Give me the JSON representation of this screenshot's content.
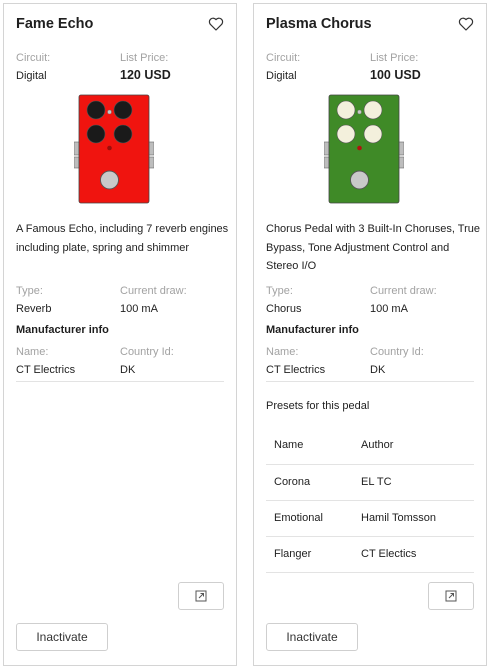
{
  "cards": [
    {
      "title": "Fame Echo",
      "circuit_label": "Circuit:",
      "circuit_value": "Digital",
      "price_label": "List Price:",
      "price_value": "120 USD",
      "pedal_color": "#f0140f",
      "knob_color": "#1a1a1a",
      "description": "A Famous Echo, including 7 reverb engines including plate, spring and shimmer",
      "type_label": "Type:",
      "type_value": "Reverb",
      "draw_label": "Current draw:",
      "draw_value": "100 mA",
      "manufacturer_heading": "Manufacturer info",
      "name_label": "Name:",
      "name_value": "CT Electrics",
      "country_label": "Country Id:",
      "country_value": "DK",
      "inactivate_label": "Inactivate"
    },
    {
      "title": "Plasma Chorus",
      "circuit_label": "Circuit:",
      "circuit_value": "Digital",
      "price_label": "List Price:",
      "price_value": "100 USD",
      "pedal_color": "#3f8a27",
      "knob_color": "#f3f0dc",
      "description": "Chorus Pedal with 3 Built-In Choruses, True Bypass, Tone Adjustment Control and Stereo I/O",
      "type_label": "Type:",
      "type_value": "Chorus",
      "draw_label": "Current draw:",
      "draw_value": "100 mA",
      "manufacturer_heading": "Manufacturer info",
      "name_label": "Name:",
      "name_value": "CT Electrics",
      "country_label": "Country Id:",
      "country_value": "DK",
      "presets_title": "Presets for this pedal",
      "presets_headers": [
        "Name",
        "Author"
      ],
      "presets": [
        {
          "name": "Corona",
          "author": "EL TC"
        },
        {
          "name": "Emotional",
          "author": "Hamil Tomsson"
        },
        {
          "name": "Flanger",
          "author": "CT Electics"
        }
      ],
      "inactivate_label": "Inactivate"
    }
  ],
  "icons": {
    "favorite": "heart-outline-icon",
    "open": "open-external-icon"
  }
}
